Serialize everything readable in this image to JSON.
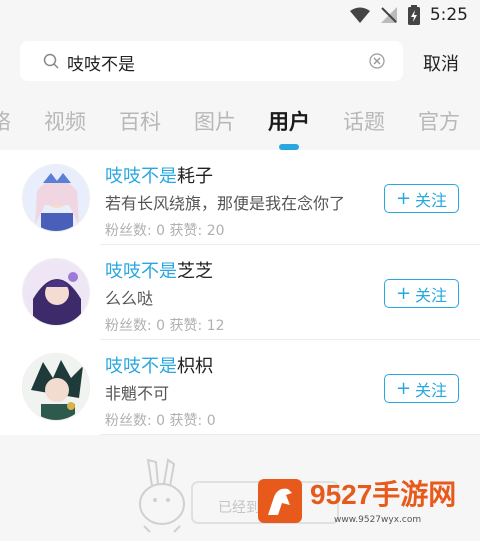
{
  "status_bar": {
    "time": "5:25"
  },
  "search": {
    "query": "吱吱不是",
    "cancel_label": "取消"
  },
  "tabs": [
    {
      "label": "络"
    },
    {
      "label": "视频"
    },
    {
      "label": "百科"
    },
    {
      "label": "图片"
    },
    {
      "label": "用户",
      "active": true
    },
    {
      "label": "话题"
    },
    {
      "label": "官方"
    }
  ],
  "users": [
    {
      "name_highlight": "吱吱不是",
      "name_rest": "耗子",
      "signature": "若有长风绕旗，那便是我在念你了",
      "stats": "粉丝数: 0 获赞: 20",
      "follow_label": "关注"
    },
    {
      "name_highlight": "吱吱不是",
      "name_rest": "芝芝",
      "signature": "么么哒",
      "stats": "粉丝数: 0 获赞: 12",
      "follow_label": "关注"
    },
    {
      "name_highlight": "吱吱不是",
      "name_rest": "枳枳",
      "signature": "非魈不可",
      "stats": "粉丝数: 0 获赞: 0",
      "follow_label": "关注"
    }
  ],
  "end_text": "已经到底了",
  "watermark": {
    "title": "9527手游网",
    "url": "www.9527wyx.com"
  }
}
